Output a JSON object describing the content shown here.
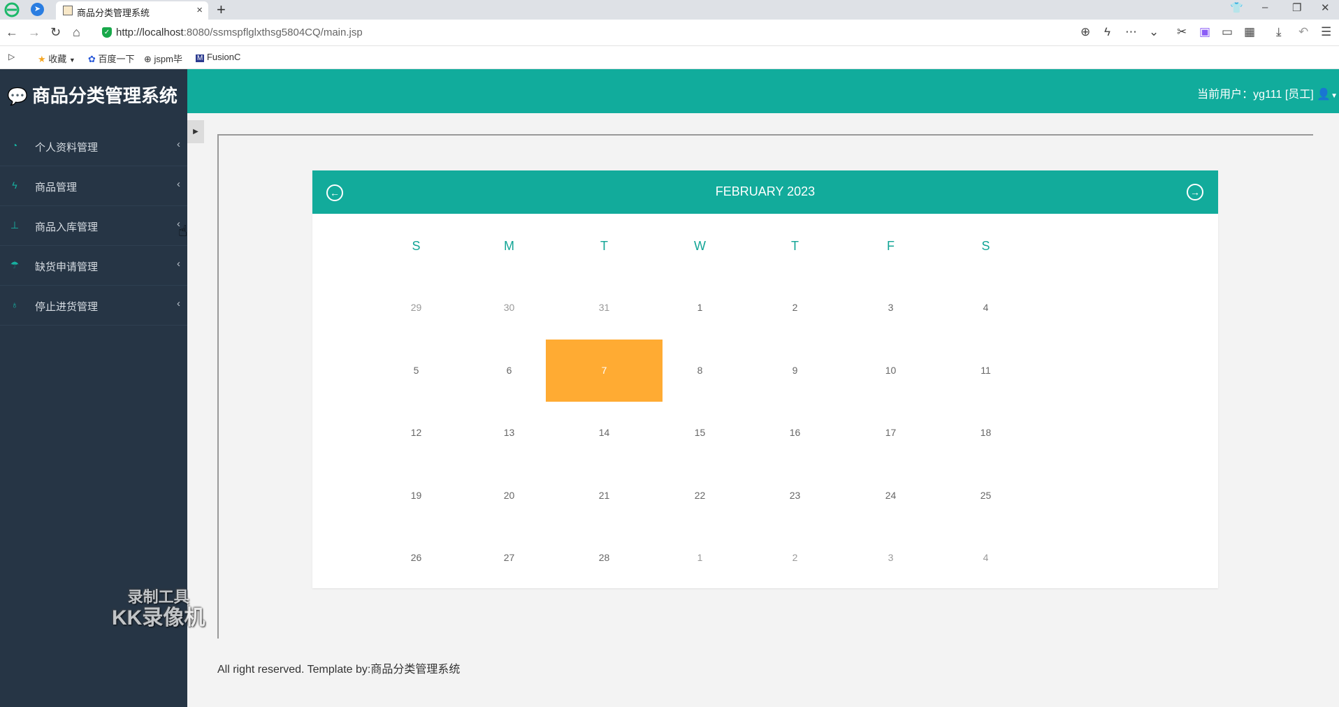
{
  "browser": {
    "tab_title": "商品分类管理系统",
    "tab_close": "×",
    "new_tab": "+",
    "url_host": "http://localhost",
    "url_rest": ":8080/ssmspflglxthsg5804CQ/main.jsp",
    "bookmarks": [
      "收藏",
      "百度一下",
      "jspm毕",
      "FusionC"
    ]
  },
  "app": {
    "brand": "商品分类管理系统",
    "current_user": "当前用户：yg111 [员工]",
    "menu": [
      {
        "label": "个人资料管理",
        "icon": "dashboard-icon"
      },
      {
        "label": "商品管理",
        "icon": "bolt-icon"
      },
      {
        "label": "商品入库管理",
        "icon": "sitemap-icon"
      },
      {
        "label": "缺货申请管理",
        "icon": "umbrella-icon"
      },
      {
        "label": "停止进货管理",
        "icon": "lightbulb-icon"
      }
    ],
    "footer": "All right reserved. Template by:商品分类管理系统"
  },
  "calendar": {
    "title": "FEBRUARY 2023",
    "weekdays": [
      "S",
      "M",
      "T",
      "W",
      "T",
      "F",
      "S"
    ],
    "weeks": [
      [
        {
          "d": "29",
          "o": true
        },
        {
          "d": "30",
          "o": true
        },
        {
          "d": "31",
          "o": true
        },
        {
          "d": "1"
        },
        {
          "d": "2"
        },
        {
          "d": "3"
        },
        {
          "d": "4"
        }
      ],
      [
        {
          "d": "5"
        },
        {
          "d": "6"
        },
        {
          "d": "7",
          "today": true
        },
        {
          "d": "8"
        },
        {
          "d": "9"
        },
        {
          "d": "10"
        },
        {
          "d": "11"
        }
      ],
      [
        {
          "d": "12"
        },
        {
          "d": "13"
        },
        {
          "d": "14"
        },
        {
          "d": "15"
        },
        {
          "d": "16"
        },
        {
          "d": "17"
        },
        {
          "d": "18"
        }
      ],
      [
        {
          "d": "19"
        },
        {
          "d": "20"
        },
        {
          "d": "21"
        },
        {
          "d": "22"
        },
        {
          "d": "23"
        },
        {
          "d": "24"
        },
        {
          "d": "25"
        }
      ],
      [
        {
          "d": "26"
        },
        {
          "d": "27"
        },
        {
          "d": "28"
        },
        {
          "d": "1",
          "o": true
        },
        {
          "d": "2",
          "o": true
        },
        {
          "d": "3",
          "o": true
        },
        {
          "d": "4",
          "o": true
        }
      ]
    ],
    "today_color": "#ffab33",
    "accent_color": "#12ab9b"
  },
  "watermark": {
    "line1": "录制工具",
    "line2": "KK录像机"
  }
}
